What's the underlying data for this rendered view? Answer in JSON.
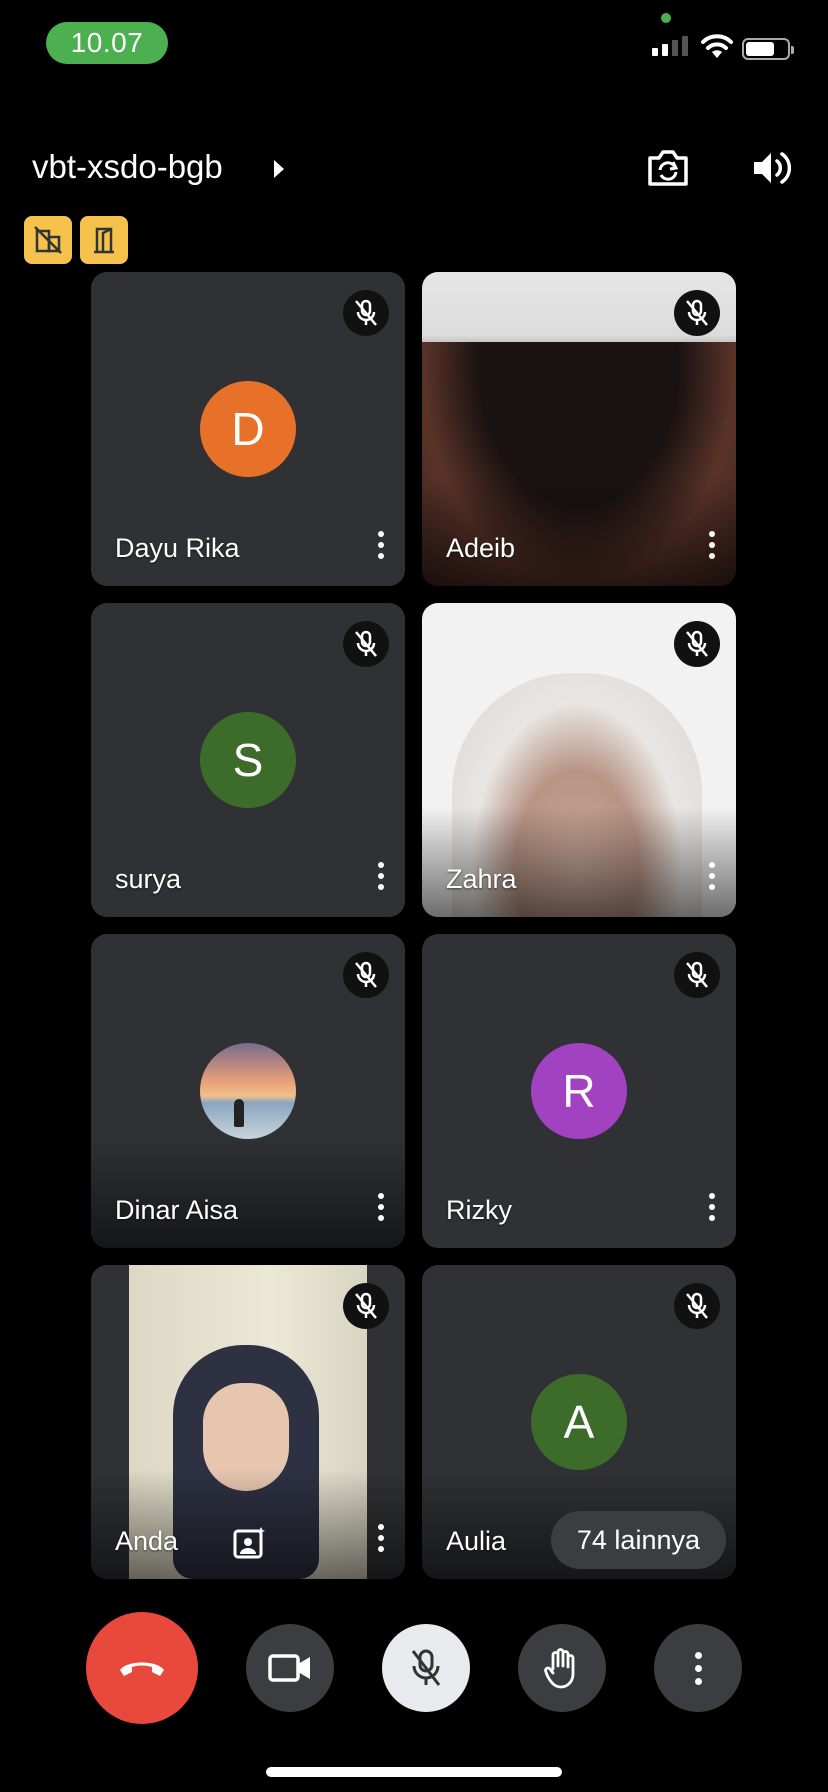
{
  "status_bar": {
    "time": "10.07"
  },
  "header": {
    "meeting_code": "vbt-xsdo-bgb"
  },
  "tiles": [
    {
      "name": "Dayu Rika",
      "initial": "D",
      "avatar_color": "#E8712A"
    },
    {
      "name": "Adeib"
    },
    {
      "name": "surya",
      "initial": "S",
      "avatar_color": "#3D6B2A"
    },
    {
      "name": "Zahra"
    },
    {
      "name": "Dinar Aisa"
    },
    {
      "name": "Rizky",
      "initial": "R",
      "avatar_color": "#A142C0"
    },
    {
      "name": "Anda"
    },
    {
      "name": "Aulia",
      "initial": "A",
      "avatar_color": "#3D6B2A"
    }
  ],
  "others_count_label": "74 lainnya",
  "colors": {
    "end_call": "#E8493C",
    "badge": "#F5C24C",
    "time_pill": "#4CAF50"
  }
}
